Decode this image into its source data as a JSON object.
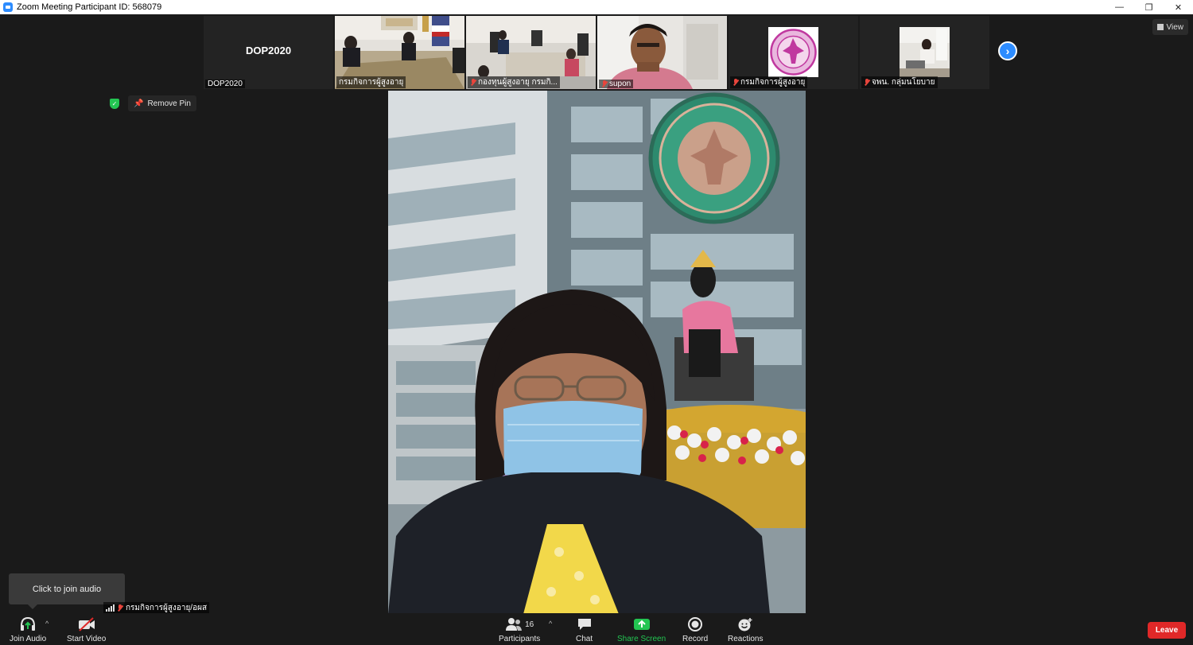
{
  "window": {
    "title": "Zoom Meeting Participant ID: 568079",
    "minimize": "—",
    "restore": "❐",
    "close": "✕"
  },
  "view_button": {
    "label": "View"
  },
  "pin": {
    "label": "Remove Pin"
  },
  "gallery": {
    "tiles": [
      {
        "name": "DOP2020",
        "center_label": "DOP2020",
        "muted": false
      },
      {
        "name": "กรมกิจการผู้สูงอายุ",
        "muted": false
      },
      {
        "name": "กองทุนผู้สูงอายุ กรมกิ...",
        "muted": true
      },
      {
        "name": "supon",
        "muted": true
      },
      {
        "name": "กรมกิจการผู้สูงอายุ",
        "muted": true
      },
      {
        "name": "จพน. กลุ่มนโยบาย",
        "muted": true
      }
    ],
    "next_icon": "›"
  },
  "self_view": {
    "name": "กรมกิจการผู้สูงอายุ/อผส"
  },
  "tooltip": {
    "text": "Click to join audio"
  },
  "toolbar": {
    "join_audio": "Join Audio",
    "start_video": "Start Video",
    "participants": "Participants",
    "participants_count": "16",
    "chat": "Chat",
    "share_screen": "Share Screen",
    "record": "Record",
    "reactions": "Reactions",
    "leave": "Leave",
    "caret": "^"
  },
  "colors": {
    "accent": "#2d8cff",
    "share": "#23c552",
    "leave": "#e02828",
    "muted": "#e8453c"
  }
}
